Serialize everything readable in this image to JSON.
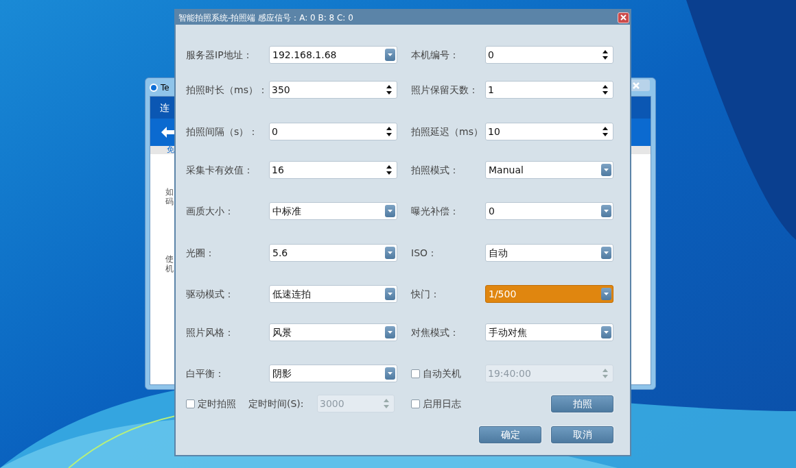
{
  "background_window": {
    "title": "Te",
    "fragments": [
      "连",
      "免",
      "如",
      "码",
      "使",
      "机"
    ]
  },
  "dialog": {
    "title": "智能拍照系统-拍照端 感应信号：A: 0 B: 8 C: 0",
    "rows": [
      {
        "left": {
          "kind": "combo",
          "label": "服务器IP地址：",
          "value": "192.168.1.68",
          "highlighted": false
        },
        "right": {
          "kind": "spin",
          "label": "本机编号：",
          "value": "0",
          "disabled": false
        }
      },
      {
        "left": {
          "kind": "spin",
          "label": "拍照时长（ms）：",
          "value": "350",
          "disabled": false
        },
        "right": {
          "kind": "spin",
          "label": "照片保留天数：",
          "value": "1",
          "disabled": false
        }
      },
      {
        "left": {
          "kind": "spin",
          "label": "拍照间隔（s）：",
          "value": "0",
          "disabled": false
        },
        "right": {
          "kind": "spin",
          "label": "拍照延迟（ms）",
          "value": "10",
          "disabled": false
        }
      },
      {
        "left": {
          "kind": "spin",
          "label": "采集卡有效值：",
          "value": "16",
          "disabled": false
        },
        "right": {
          "kind": "combo",
          "label": "拍照模式：",
          "value": "Manual",
          "highlighted": false
        }
      },
      {
        "left": {
          "kind": "combo",
          "label": "画质大小：",
          "value": "中标准",
          "highlighted": false
        },
        "right": {
          "kind": "combo",
          "label": "曝光补偿：",
          "value": "0",
          "highlighted": false
        }
      },
      {
        "left": {
          "kind": "combo",
          "label": "光圈：",
          "value": "5.6",
          "highlighted": false
        },
        "right": {
          "kind": "combo",
          "label": "ISO：",
          "value": "自动",
          "highlighted": false
        }
      },
      {
        "left": {
          "kind": "combo",
          "label": "驱动模式：",
          "value": "低速连拍",
          "highlighted": false
        },
        "right": {
          "kind": "combo",
          "label": "快门：",
          "value": "1/500",
          "highlighted": true
        }
      },
      {
        "left": {
          "kind": "combo",
          "label": "照片风格：",
          "value": "风景",
          "highlighted": false
        },
        "right": {
          "kind": "combo",
          "label": "对焦模式：",
          "value": "手动对焦",
          "highlighted": false
        }
      },
      {
        "left": {
          "kind": "combo",
          "label": "白平衡：",
          "value": "阴影",
          "highlighted": false
        },
        "right": {
          "kind": "check_spin",
          "label": "自动关机",
          "checked": false,
          "value": "19:40:00",
          "disabled": true
        }
      },
      {
        "left": {
          "kind": "check_label_spin",
          "label": "定时拍照",
          "checked": false,
          "sublabel": "定时时间(S):",
          "value": "3000",
          "disabled": true
        },
        "right": {
          "kind": "check_button",
          "label": "启用日志",
          "checked": false,
          "button": "拍照"
        }
      }
    ],
    "buttons": [
      "确定",
      "取消"
    ]
  }
}
